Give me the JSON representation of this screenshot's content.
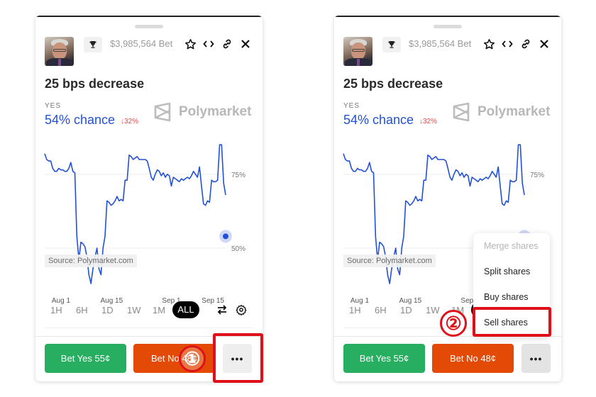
{
  "header": {
    "volume": "$3,985,564 Bet",
    "icons": [
      "trophy-icon",
      "star-icon",
      "code-icon",
      "link-icon",
      "close-icon"
    ]
  },
  "market": {
    "title": "25 bps decrease",
    "outcome_label": "YES",
    "chance": "54% chance",
    "delta": "↓32%",
    "brand": "Polymarket"
  },
  "chart_data": {
    "type": "line",
    "title": "",
    "xlabel": "",
    "ylabel": "",
    "source": "Source: Polymarket.com",
    "x_tick_labels": [
      "Aug 1",
      "Aug 15",
      "Sep 1",
      "Sep 15"
    ],
    "y_tick_labels": [
      "75%",
      "50%"
    ],
    "y_ticks": [
      75,
      50
    ],
    "ylim": [
      38,
      86
    ],
    "grid": true,
    "series": [
      {
        "name": "YES",
        "color": "#2351d6",
        "x": [
          0,
          1,
          2,
          3,
          4,
          5,
          6,
          7,
          8,
          9,
          10,
          11,
          12,
          13,
          14,
          15,
          16,
          17,
          18,
          19,
          20,
          21,
          22,
          23,
          24,
          25,
          26,
          27,
          28,
          29,
          30,
          31,
          32,
          33,
          34,
          35,
          36,
          37,
          38,
          39,
          40,
          41,
          42,
          43,
          44,
          45,
          46,
          47,
          48,
          49,
          50,
          51,
          52,
          53,
          54,
          55,
          56,
          57,
          58,
          59,
          60,
          61,
          62,
          63,
          64,
          65,
          66,
          67,
          68,
          69,
          70,
          71,
          72,
          73,
          74,
          75,
          76,
          77,
          78,
          79,
          80,
          81,
          82,
          83,
          84,
          85,
          86,
          87,
          88,
          89,
          90
        ],
        "values": [
          82,
          80,
          79.5,
          79.5,
          77,
          76,
          76,
          77,
          76.5,
          76.5,
          76,
          76,
          77,
          79,
          76,
          75.5,
          54,
          46,
          52,
          51.5,
          50.5,
          47,
          41,
          38,
          43,
          47,
          50,
          43,
          41,
          50,
          54,
          66,
          65.5,
          64.5,
          65,
          66,
          67.5,
          66,
          66.5,
          66,
          73,
          73,
          81.5,
          81,
          80,
          80.5,
          81,
          80,
          80,
          80,
          80,
          79.5,
          77,
          74,
          73,
          75,
          76.5,
          76,
          74.5,
          75.5,
          74,
          75,
          74.5,
          71,
          74,
          73.5,
          73,
          72.5,
          73.5,
          73,
          73.5,
          74,
          73.5,
          74.5,
          76,
          75,
          74,
          77.5,
          71,
          65,
          64.5,
          66,
          65.5,
          73,
          72.5,
          72.5,
          73,
          85,
          85,
          72,
          68
        ]
      }
    ],
    "last_point": 54
  },
  "ranges": {
    "options": [
      "1H",
      "6H",
      "1D",
      "1W",
      "1M",
      "ALL"
    ],
    "selected": "ALL"
  },
  "tools": {
    "swap_icon": "swap-icon",
    "settings_icon": "gear-icon"
  },
  "actions": {
    "bet_yes": "Bet Yes 55¢",
    "bet_no": "Bet No 48¢",
    "more": "•••"
  },
  "menu": {
    "items": [
      {
        "label": "Merge shares",
        "disabled": true
      },
      {
        "label": "Split shares",
        "disabled": false
      },
      {
        "label": "Buy shares",
        "disabled": false
      },
      {
        "label": "Sell shares",
        "disabled": false
      }
    ]
  },
  "annotations": {
    "step1": "①",
    "step2": "②",
    "highlight_color": "#e0101a"
  }
}
